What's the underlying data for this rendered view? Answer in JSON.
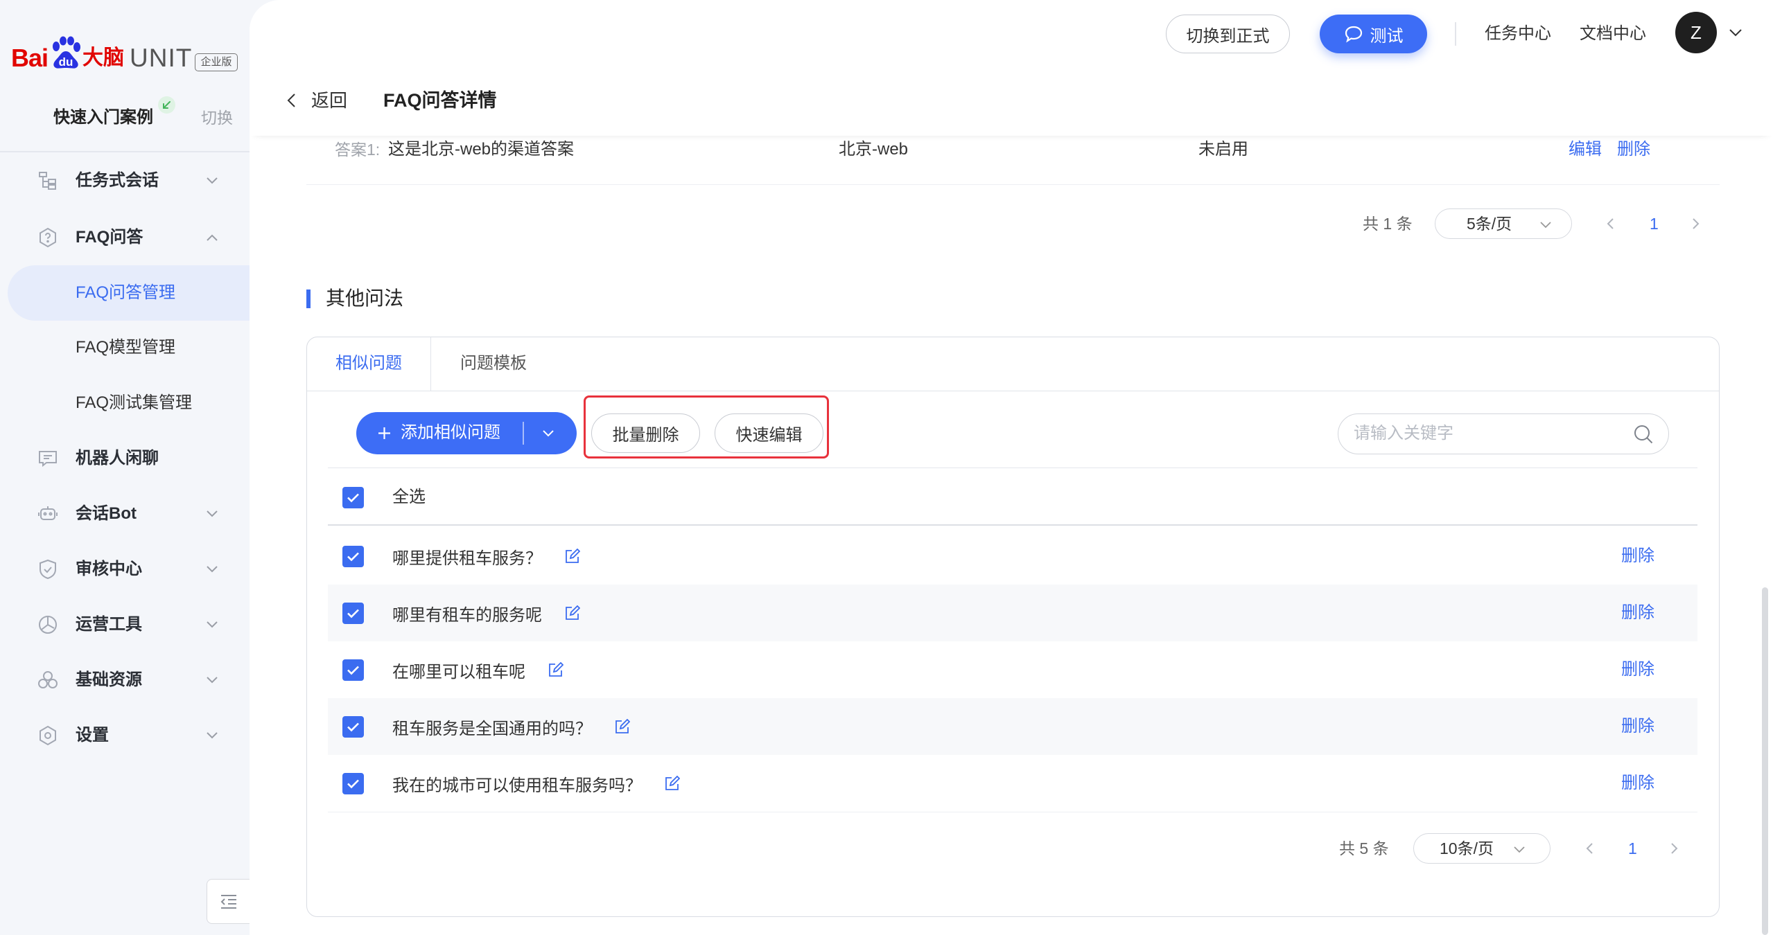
{
  "brand": {
    "bai": "Bai",
    "du": "du",
    "danao": "大脑",
    "unit": "UNIT",
    "edition": "企业版"
  },
  "sidebar": {
    "case_name": "快速入门案例",
    "switch": "切换",
    "menu": [
      {
        "label": "任务式会话",
        "icon": "task-dialog-icon",
        "expandable": true,
        "expanded": false
      },
      {
        "label": "FAQ问答",
        "icon": "faq-icon",
        "expandable": true,
        "expanded": true,
        "children": [
          {
            "label": "FAQ问答管理",
            "active": true
          },
          {
            "label": "FAQ模型管理",
            "active": false
          },
          {
            "label": "FAQ测试集管理",
            "active": false
          }
        ]
      },
      {
        "label": "机器人闲聊",
        "icon": "chat-bubble-icon",
        "expandable": false
      },
      {
        "label": "会话Bot",
        "icon": "robot-icon",
        "expandable": true,
        "expanded": false
      },
      {
        "label": "审核中心",
        "icon": "audit-shield-icon",
        "expandable": true,
        "expanded": false
      },
      {
        "label": "运营工具",
        "icon": "operation-tool-icon",
        "expandable": true,
        "expanded": false
      },
      {
        "label": "基础资源",
        "icon": "base-resource-icon",
        "expandable": true,
        "expanded": false
      },
      {
        "label": "设置",
        "icon": "settings-icon",
        "expandable": true,
        "expanded": false
      }
    ]
  },
  "topbar": {
    "switch_formal": "切换到正式",
    "test": "测试",
    "task_center": "任务中心",
    "doc_center": "文档中心",
    "avatar_initial": "Z"
  },
  "page": {
    "back": "返回",
    "title": "FAQ问答详情"
  },
  "answers": {
    "rows": [
      {
        "prefix": "答案1:",
        "text": "这是北京-web的渠道答案",
        "channel": "北京-web",
        "status": "未启用",
        "edit": "编辑",
        "delete": "删除"
      }
    ],
    "pagination": {
      "total": "共 1 条",
      "page_size": "5条/页",
      "current_page": "1"
    }
  },
  "other_questions": {
    "section_title": "其他问法",
    "tabs": [
      {
        "label": "相似问题",
        "active": true
      },
      {
        "label": "问题模板",
        "active": false
      }
    ],
    "add_button": "添加相似问题",
    "batch_delete": "批量删除",
    "quick_edit": "快速编辑",
    "search_placeholder": "请输入关键字",
    "search_value": "",
    "select_all": {
      "label": "全选",
      "checked": true
    },
    "row_delete": "删除",
    "questions": [
      {
        "text": "哪里提供租车服务？",
        "checked": true
      },
      {
        "text": "哪里有租车的服务呢",
        "checked": true
      },
      {
        "text": "在哪里可以租车呢",
        "checked": true
      },
      {
        "text": "租车服务是全国通用的吗？",
        "checked": true
      },
      {
        "text": "我在的城市可以使用租车服务吗？",
        "checked": true
      }
    ],
    "pagination": {
      "total": "共 5 条",
      "page_size": "10条/页",
      "current_page": "1"
    }
  },
  "colors": {
    "accent": "#3b6cf0",
    "highlight_box": "#e8323c",
    "brand_red": "#e10602",
    "brand_blue": "#2932e1",
    "sidebar_bg": "#f4f6fa",
    "active_menu_bg": "#e6ecfb"
  }
}
